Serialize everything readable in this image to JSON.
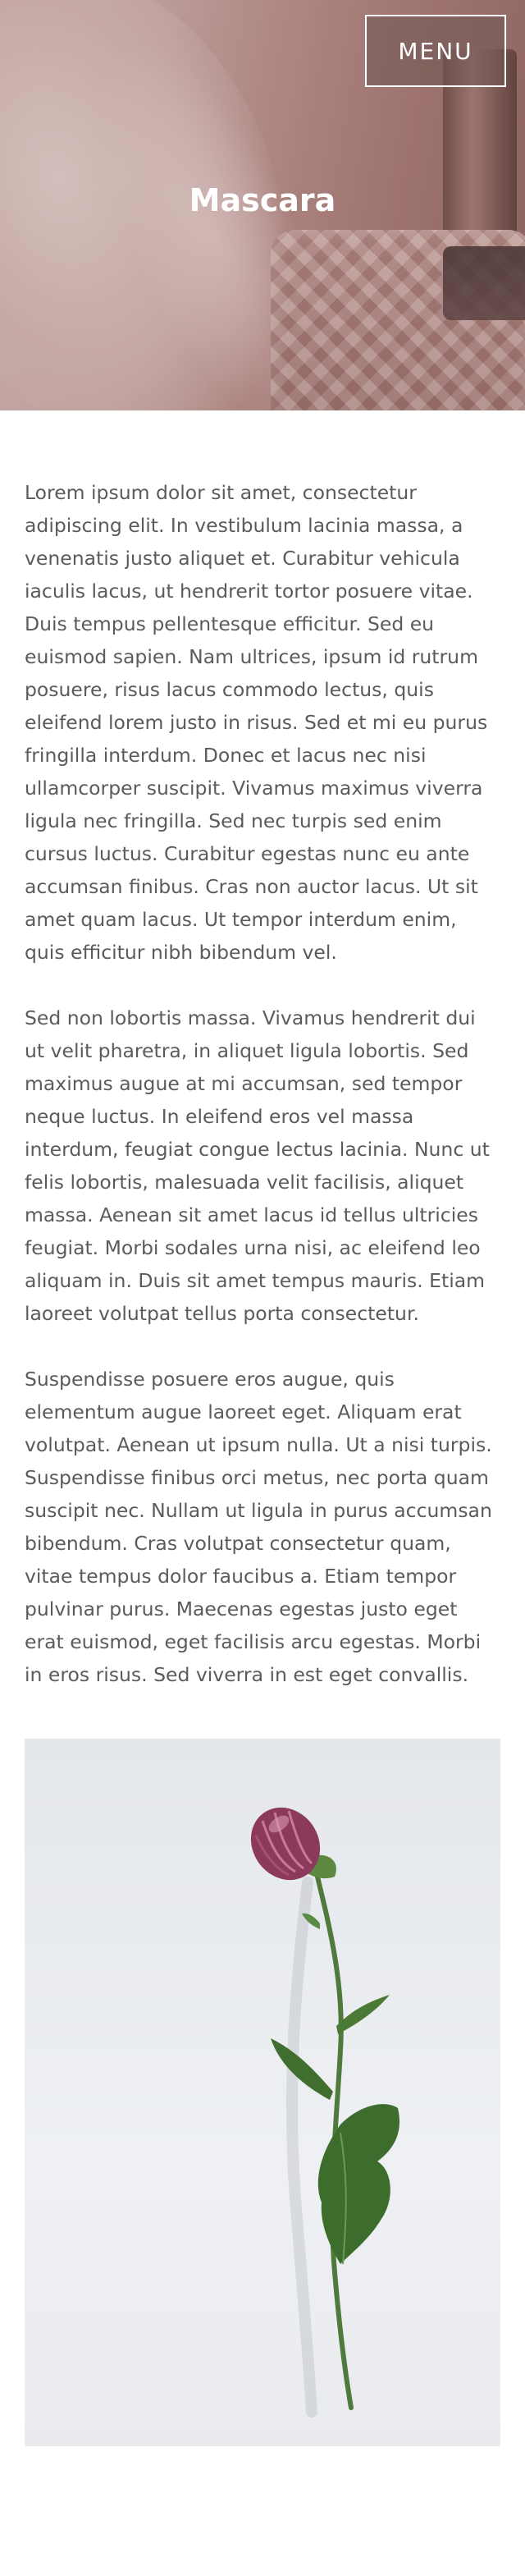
{
  "header": {
    "menu_label": "MENU",
    "title": "Mascara"
  },
  "article": {
    "paragraphs": [
      "Lorem ipsum dolor sit amet, consectetur adipiscing elit. In vestibulum lacinia massa, a venenatis justo aliquet et. Curabitur vehicula iaculis lacus, ut hendrerit tortor posuere vitae. Duis tempus pellentesque efficitur. Sed eu euismod sapien. Nam ultrices, ipsum id rutrum posuere, risus lacus commodo lectus, quis eleifend lorem justo in risus. Sed et mi eu purus fringilla interdum. Donec et lacus nec nisi ullamcorper suscipit. Vivamus maximus viverra ligula nec fringilla. Sed nec turpis sed enim cursus luctus. Curabitur egestas nunc eu ante accumsan finibus. Cras non auctor lacus. Ut sit amet quam lacus. Ut tempor interdum enim, quis efficitur nibh bibendum vel.",
      "Sed non lobortis massa. Vivamus hendrerit dui ut velit pharetra, in aliquet ligula lobortis. Sed maximus augue at mi accumsan, sed tempor neque luctus. In eleifend eros vel massa interdum, feugiat congue lectus lacinia. Nunc ut felis lobortis, malesuada velit facilisis, aliquet massa. Aenean sit amet lacus id tellus ultricies feugiat. Morbi sodales urna nisi, ac eleifend leo aliquam in. Duis sit amet tempus mauris. Etiam laoreet volutpat tellus porta consectetur.",
      "Suspendisse posuere eros augue, quis elementum augue laoreet eget. Aliquam erat volutpat. Aenean ut ipsum nulla. Ut a nisi turpis. Suspendisse finibus orci metus, nec porta quam suscipit nec. Nullam ut ligula in purus accumsan bibendum. Cras volutpat consectetur quam, vitae tempus dolor faucibus a. Etiam tempor pulvinar purus. Maecenas egestas justo eget erat euismod, eget facilisis arcu egestas. Morbi in eros risus. Sed viverra in est eget convallis."
    ]
  },
  "colors": {
    "text": "#5b5b5b",
    "title": "#ffffff",
    "background": "#ffffff"
  }
}
